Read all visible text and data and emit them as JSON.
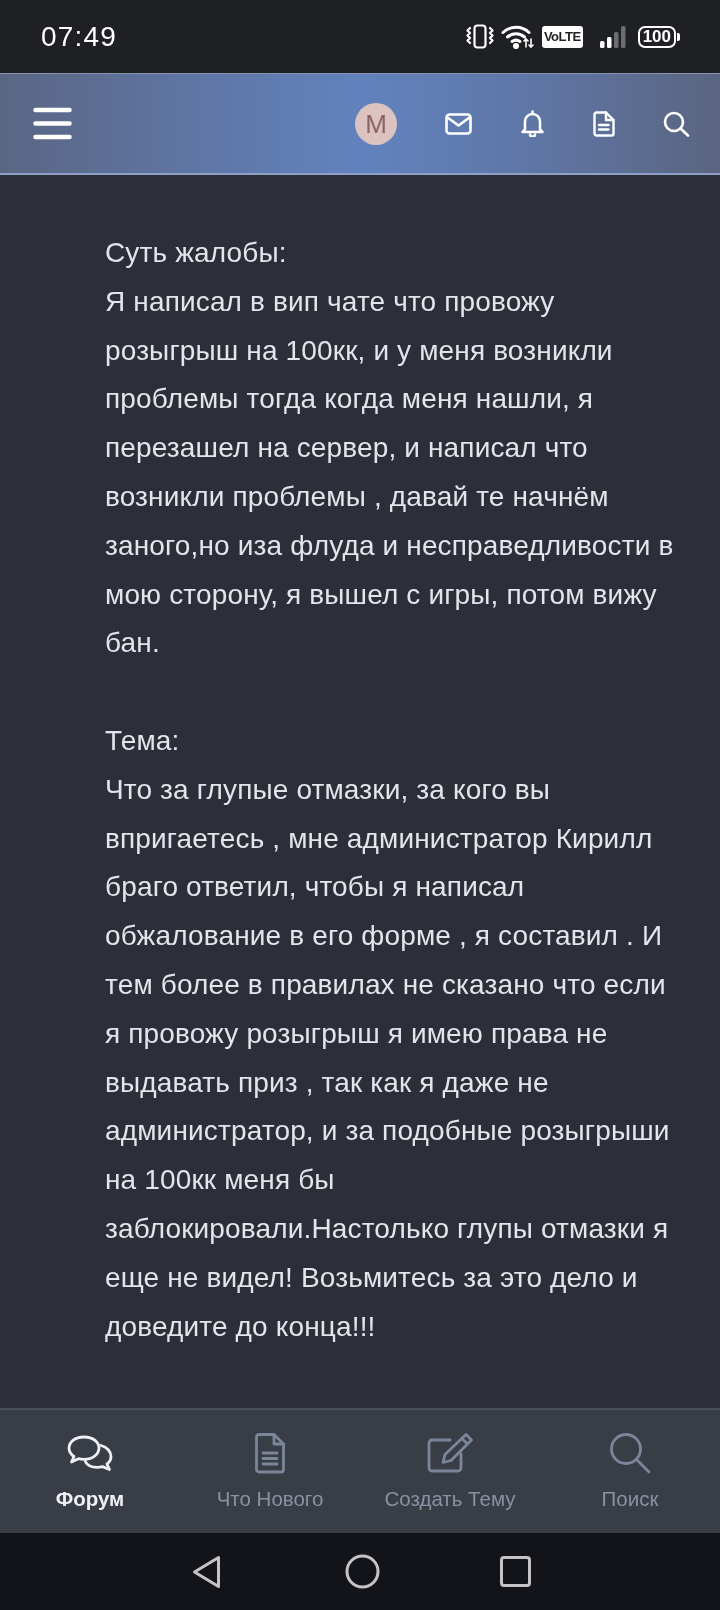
{
  "status_bar": {
    "time": "07:49",
    "network_badge": "VoLTE",
    "battery": "100"
  },
  "header": {
    "avatar_letter": "M"
  },
  "post": {
    "sections": [
      {
        "heading": "Суть жалобы:",
        "text": "Я написал в вип чате что провожу розыгрыш на 100кк, и у меня возникли проблемы тогда когда меня нашли, я перезашел на сервер, и написал что возникли проблемы , давай те начнём заного,но иза флуда и несправедливости в мою сторону, я вышел с игры, потом вижу бан."
      },
      {
        "heading": "Тема:",
        "text": "Что за глупые отмазки, за кого вы впригаетесь , мне администратор Кирилл браго ответил, чтобы я написал обжалование в его форме , я составил . И тем более в правилах не сказано что если я провожу розыгрыш я имею права не выдавать приз , так как я даже не администратор, и за подобные розыгрыши на 100кк меня бы заблокировали.Настолько глупы отмазки я еще не видел! Возьмитесь за это дело и доведите до конца!!!"
      }
    ]
  },
  "bottom_nav": [
    {
      "kind": "forum",
      "label": "Форум",
      "selected": true
    },
    {
      "kind": "new",
      "label": "Что Нового",
      "selected": false
    },
    {
      "kind": "create",
      "label": "Создать Тему",
      "selected": false
    },
    {
      "kind": "search",
      "label": "Поиск",
      "selected": false
    }
  ]
}
